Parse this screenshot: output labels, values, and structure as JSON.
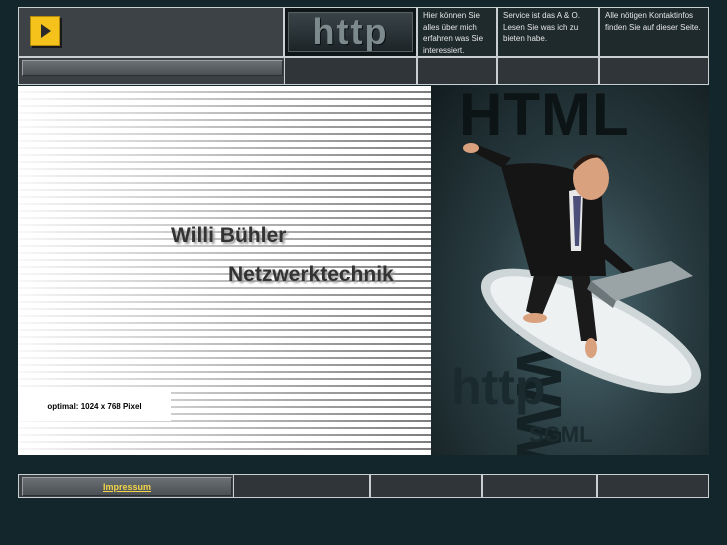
{
  "header": {
    "arrow_button_icon": "play-arrow-icon",
    "http_logo_text": "http",
    "info_1": "Hier können Sie alles über mich erfahren was Sie interessiert.",
    "info_2": "Service ist das A & O. Lesen Sie was ich zu bieten habe.",
    "info_3": "Alle nötigen Kontaktinfos finden Sie auf dieser Seite."
  },
  "hero": {
    "name": "Willi Bühler",
    "subtitle": "Netzwerktechnik",
    "resolution_note": "optimal: 1024 x 768 Pixel",
    "image_words": {
      "html": "HTML",
      "www": "WWW",
      "http": "http",
      "sgml": "SGML"
    }
  },
  "footer": {
    "impressum": "Impressum"
  },
  "colors": {
    "page_background": "#13262b",
    "link_color": "#f2d54a",
    "arrow_button": "#f4c21b"
  }
}
